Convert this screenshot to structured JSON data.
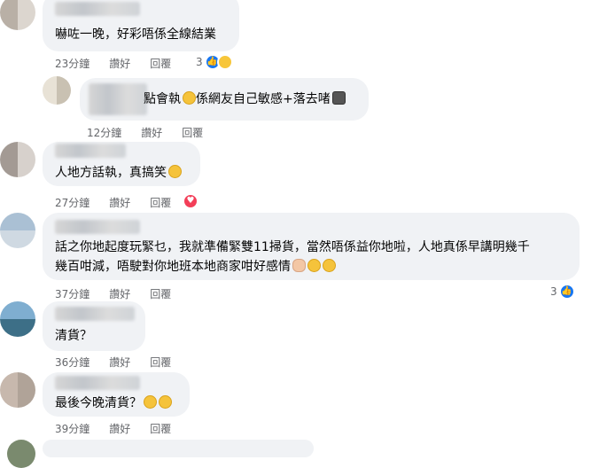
{
  "comments": [
    {
      "text": "嚇咗一晚，好彩唔係全線結業",
      "time": "23分鐘",
      "like": "讚好",
      "reply": "回覆",
      "reaction_count": "3"
    },
    {
      "text": "點會執",
      "text2": "係網友自己敏感+落去啫",
      "time": "12分鐘",
      "like": "讚好",
      "reply": "回覆"
    },
    {
      "text": "人地方話執，真搞笑",
      "time": "27分鐘",
      "like": "讚好",
      "reply": "回覆"
    },
    {
      "line1": "話之你地起度玩緊乜，我就準備緊雙11掃貨，當然唔係益你地啦，人地真係早講明幾千",
      "line2": "幾百咁減，唔駛對你地班本地商家咁好感情",
      "time": "37分鐘",
      "like": "讚好",
      "reply": "回覆",
      "reaction_count": "3"
    },
    {
      "text": "清貨？",
      "time": "36分鐘",
      "like": "讚好",
      "reply": "回覆"
    },
    {
      "text": "最後今晚清貨？",
      "time": "39分鐘",
      "like": "讚好",
      "reply": "回覆"
    }
  ],
  "icons": {
    "like": "like-icon",
    "haha": "haha-icon",
    "love": "love-icon"
  },
  "colors": {
    "bubble": "#f0f2f5",
    "meta": "#65676b",
    "like_blue": "#1877f2",
    "love_red": "#f33e58"
  }
}
